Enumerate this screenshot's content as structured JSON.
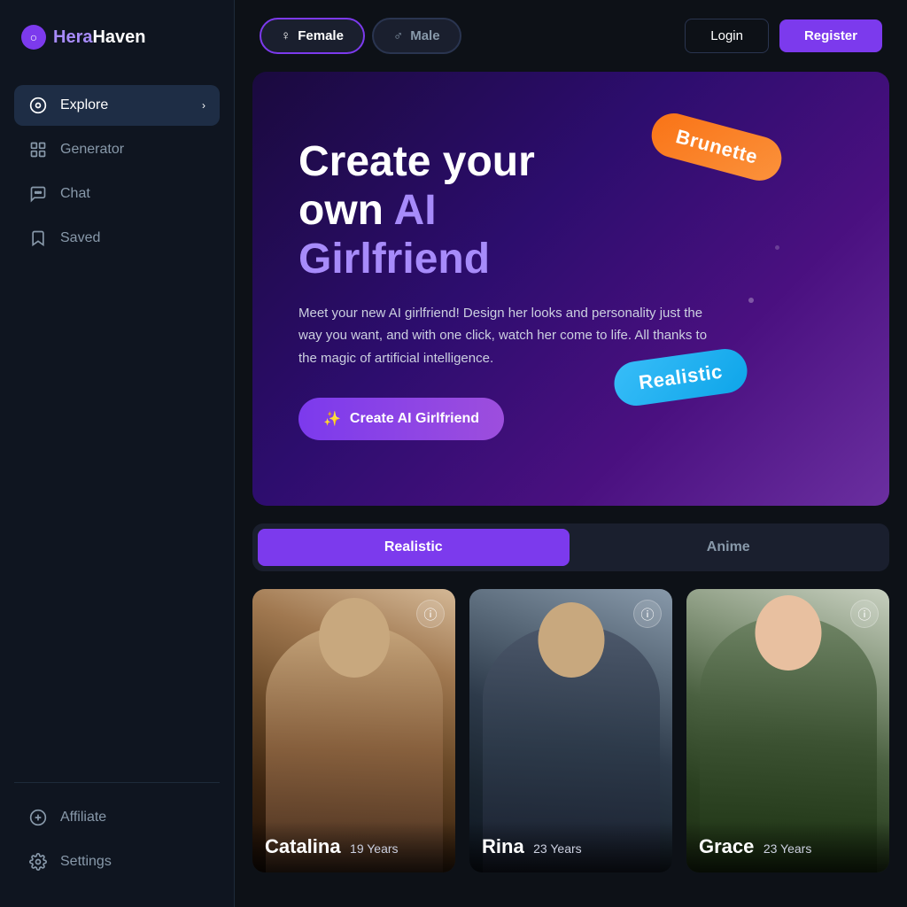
{
  "logo": {
    "icon": "○",
    "brand_part1": "Hera",
    "brand_part2": "Haven"
  },
  "sidebar": {
    "nav_items": [
      {
        "id": "explore",
        "label": "Explore",
        "icon": "⊙",
        "active": true,
        "has_chevron": true
      },
      {
        "id": "generator",
        "label": "Generator",
        "icon": "⊞",
        "active": false,
        "has_chevron": false
      },
      {
        "id": "chat",
        "label": "Chat",
        "icon": "◎",
        "active": false,
        "has_chevron": false
      },
      {
        "id": "saved",
        "label": "Saved",
        "icon": "⊡",
        "active": false,
        "has_chevron": false
      }
    ],
    "bottom_items": [
      {
        "id": "affiliate",
        "label": "Affiliate",
        "icon": "◈"
      },
      {
        "id": "settings",
        "label": "Settings",
        "icon": "⚙"
      }
    ]
  },
  "header": {
    "gender_options": [
      {
        "id": "female",
        "label": "Female",
        "icon": "♀",
        "active": true
      },
      {
        "id": "male",
        "label": "Male",
        "icon": "♂",
        "active": false
      }
    ],
    "login_label": "Login",
    "register_label": "Register"
  },
  "hero": {
    "title_line1": "Create your",
    "title_line2": "own ",
    "title_highlight": "AI",
    "title_line3": "Girlfriend",
    "description": "Meet your new AI girlfriend! Design her looks and personality just the way you want, and with one click, watch her come to life. All thanks to the magic of artificial intelligence.",
    "cta_label": "Create AI Girlfriend",
    "pill1": "Brunette",
    "pill2": "Realistic"
  },
  "tabs": [
    {
      "id": "realistic",
      "label": "Realistic",
      "active": true
    },
    {
      "id": "anime",
      "label": "Anime",
      "active": false
    }
  ],
  "cards": [
    {
      "id": "catalina",
      "name": "Catalina",
      "age": "19 Years",
      "bg_class": "card-1-bg"
    },
    {
      "id": "rina",
      "name": "Rina",
      "age": "23 Years",
      "bg_class": "card-2-bg"
    },
    {
      "id": "grace",
      "name": "Grace",
      "age": "23 Years",
      "bg_class": "card-3-bg"
    }
  ],
  "colors": {
    "accent": "#7c3aed",
    "accent_light": "#a78bfa",
    "bg_dark": "#0d1117",
    "bg_sidebar": "#0f1520"
  }
}
